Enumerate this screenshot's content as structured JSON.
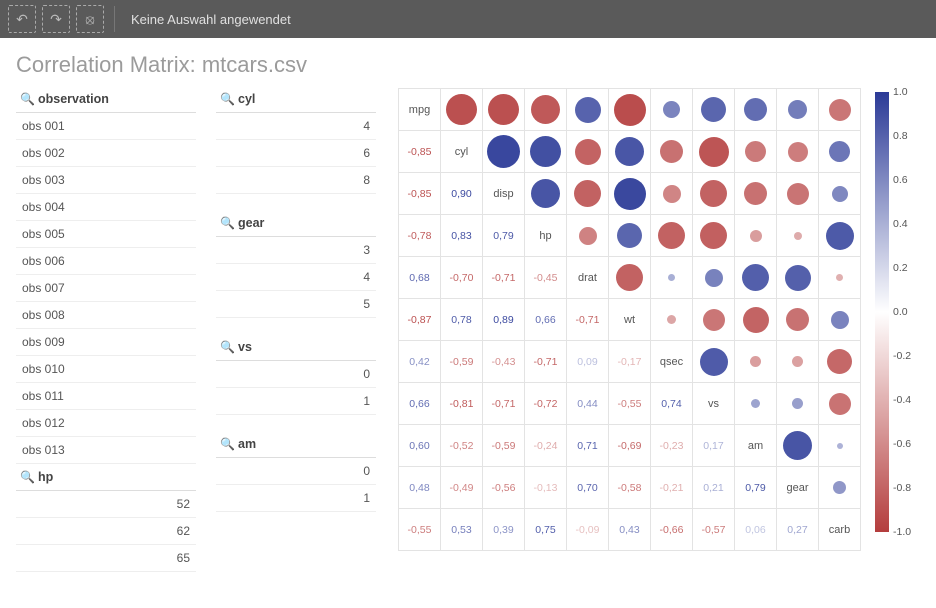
{
  "toolbar": {
    "status_text": "Keine Auswahl angewendet"
  },
  "title": "Correlation Matrix: mtcars.csv",
  "sidebar": {
    "observation": {
      "header": "observation",
      "items": [
        "obs 001",
        "obs 002",
        "obs 003",
        "obs 004",
        "obs 005",
        "obs 006",
        "obs 007",
        "obs 008",
        "obs 009",
        "obs 010",
        "obs 011",
        "obs 012",
        "obs 013"
      ]
    },
    "hp": {
      "header": "hp",
      "items": [
        "52",
        "62",
        "65"
      ]
    },
    "cyl": {
      "header": "cyl",
      "items": [
        "4",
        "6",
        "8"
      ]
    },
    "gear": {
      "header": "gear",
      "items": [
        "3",
        "4",
        "5"
      ]
    },
    "vs": {
      "header": "vs",
      "items": [
        "0",
        "1"
      ]
    },
    "am": {
      "header": "am",
      "items": [
        "0",
        "1"
      ]
    }
  },
  "colors": {
    "pos": "#2b3a97",
    "neg": "#b43d3d"
  },
  "chart_data": {
    "type": "heatmap",
    "title": "Correlation Matrix: mtcars.csv",
    "variables": [
      "mpg",
      "cyl",
      "disp",
      "hp",
      "drat",
      "wt",
      "qsec",
      "vs",
      "am",
      "gear",
      "carb"
    ],
    "range": [
      -1.0,
      1.0
    ],
    "legend_ticks": [
      1.0,
      0.8,
      0.6,
      0.4,
      0.2,
      0.0,
      -0.2,
      -0.4,
      -0.6,
      -0.8,
      -1.0
    ],
    "matrix": [
      [
        1.0,
        -0.85,
        -0.85,
        -0.78,
        0.68,
        -0.87,
        0.42,
        0.66,
        0.6,
        0.48,
        -0.55
      ],
      [
        -0.85,
        1.0,
        0.9,
        0.83,
        -0.7,
        0.78,
        -0.59,
        -0.81,
        -0.52,
        -0.49,
        0.53
      ],
      [
        -0.85,
        0.9,
        1.0,
        0.79,
        -0.71,
        0.89,
        -0.43,
        -0.71,
        -0.59,
        -0.56,
        0.39
      ],
      [
        -0.78,
        0.83,
        0.79,
        1.0,
        -0.45,
        0.66,
        -0.71,
        -0.72,
        -0.24,
        -0.13,
        0.75
      ],
      [
        0.68,
        -0.7,
        -0.71,
        -0.45,
        1.0,
        -0.71,
        0.09,
        0.44,
        0.71,
        0.7,
        -0.09
      ],
      [
        -0.87,
        0.78,
        0.89,
        0.66,
        -0.71,
        1.0,
        -0.17,
        -0.55,
        -0.69,
        -0.58,
        0.43
      ],
      [
        0.42,
        -0.59,
        -0.43,
        -0.71,
        0.09,
        -0.17,
        1.0,
        0.74,
        -0.23,
        -0.21,
        -0.66
      ],
      [
        0.66,
        -0.81,
        -0.71,
        -0.72,
        0.44,
        -0.55,
        0.74,
        1.0,
        0.17,
        0.21,
        -0.57
      ],
      [
        0.6,
        -0.52,
        -0.59,
        -0.24,
        0.71,
        -0.69,
        -0.23,
        0.17,
        1.0,
        0.79,
        0.06
      ],
      [
        0.48,
        -0.49,
        -0.56,
        -0.13,
        0.7,
        -0.58,
        -0.21,
        0.21,
        0.79,
        1.0,
        0.27
      ],
      [
        -0.55,
        0.53,
        0.39,
        0.75,
        -0.09,
        0.43,
        -0.66,
        -0.57,
        0.06,
        0.27,
        1.0
      ]
    ]
  }
}
